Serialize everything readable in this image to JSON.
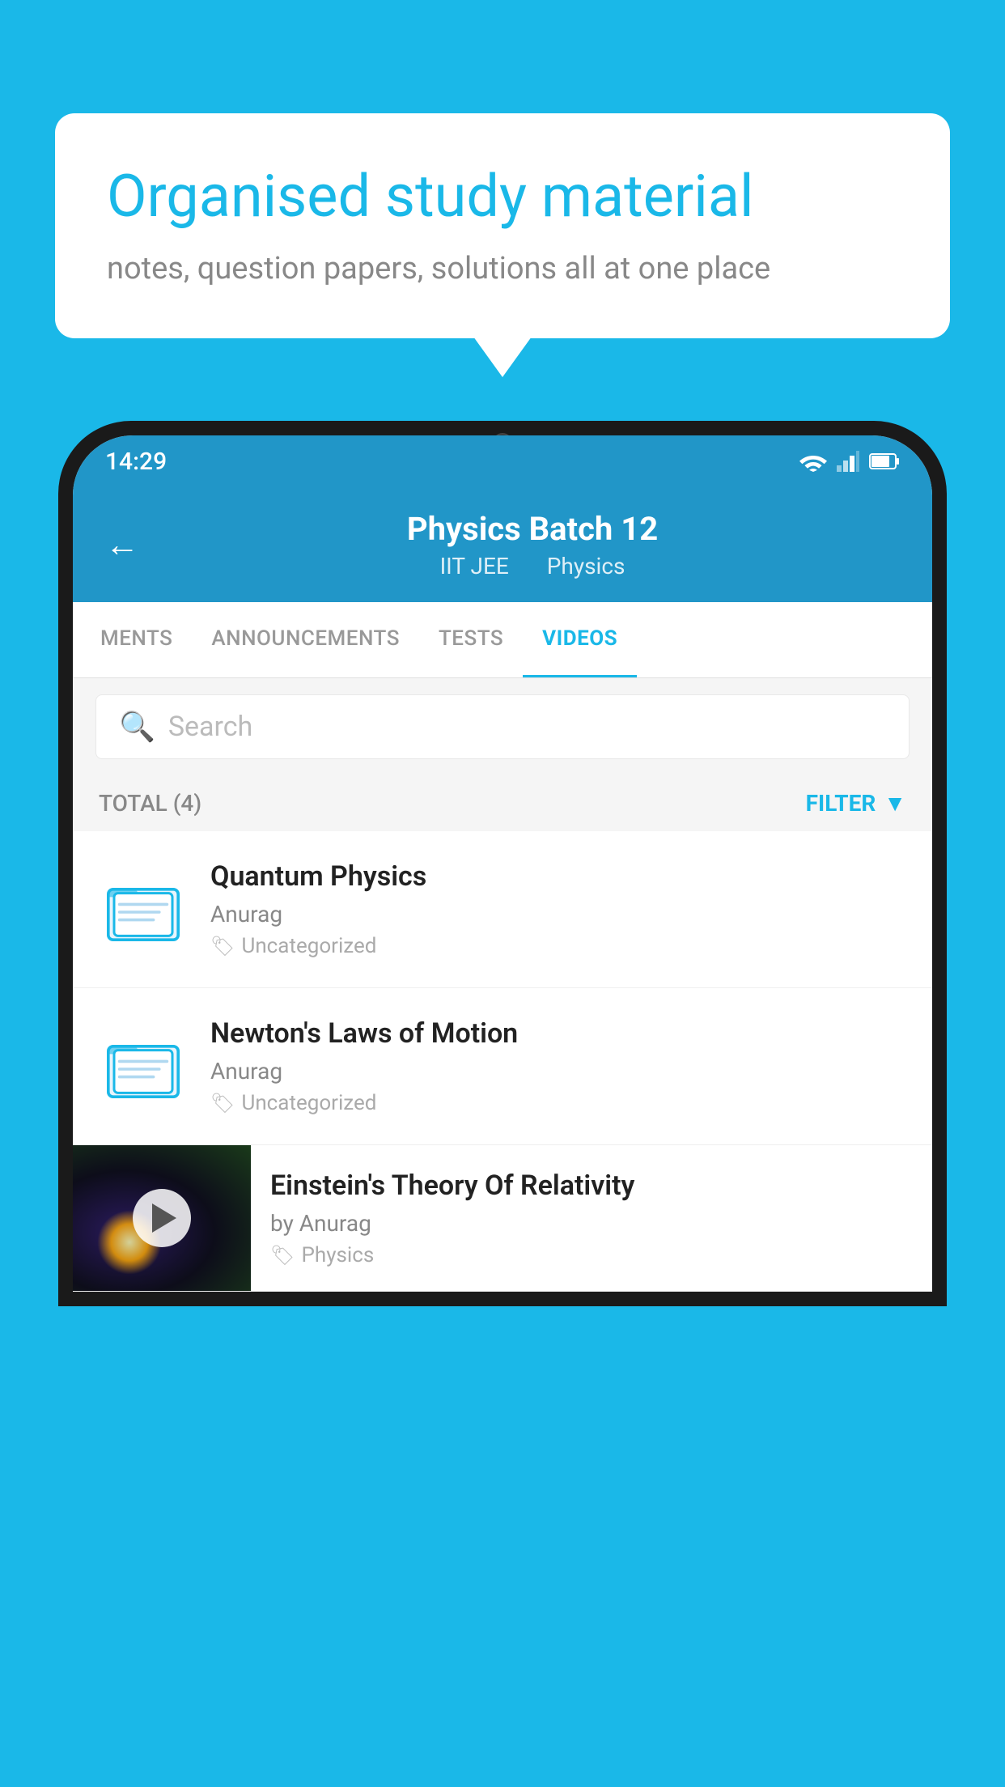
{
  "background_color": "#1ab8e8",
  "speech_bubble": {
    "title": "Organised study material",
    "subtitle": "notes, question papers, solutions all at one place"
  },
  "status_bar": {
    "time": "14:29"
  },
  "app_header": {
    "title": "Physics Batch 12",
    "subtitle1": "IIT JEE",
    "subtitle2": "Physics",
    "back_label": "←"
  },
  "tabs": [
    {
      "label": "MENTS",
      "active": false
    },
    {
      "label": "ANNOUNCEMENTS",
      "active": false
    },
    {
      "label": "TESTS",
      "active": false
    },
    {
      "label": "VIDEOS",
      "active": true
    }
  ],
  "search": {
    "placeholder": "Search"
  },
  "filter_bar": {
    "total_label": "TOTAL (4)",
    "filter_label": "FILTER"
  },
  "videos": [
    {
      "id": 1,
      "type": "folder",
      "title": "Quantum Physics",
      "author": "Anurag",
      "tag": "Uncategorized"
    },
    {
      "id": 2,
      "type": "folder",
      "title": "Newton's Laws of Motion",
      "author": "Anurag",
      "tag": "Uncategorized"
    },
    {
      "id": 3,
      "type": "video",
      "title": "Einstein's Theory Of Relativity",
      "author": "by Anurag",
      "tag": "Physics",
      "has_thumb": true
    }
  ]
}
